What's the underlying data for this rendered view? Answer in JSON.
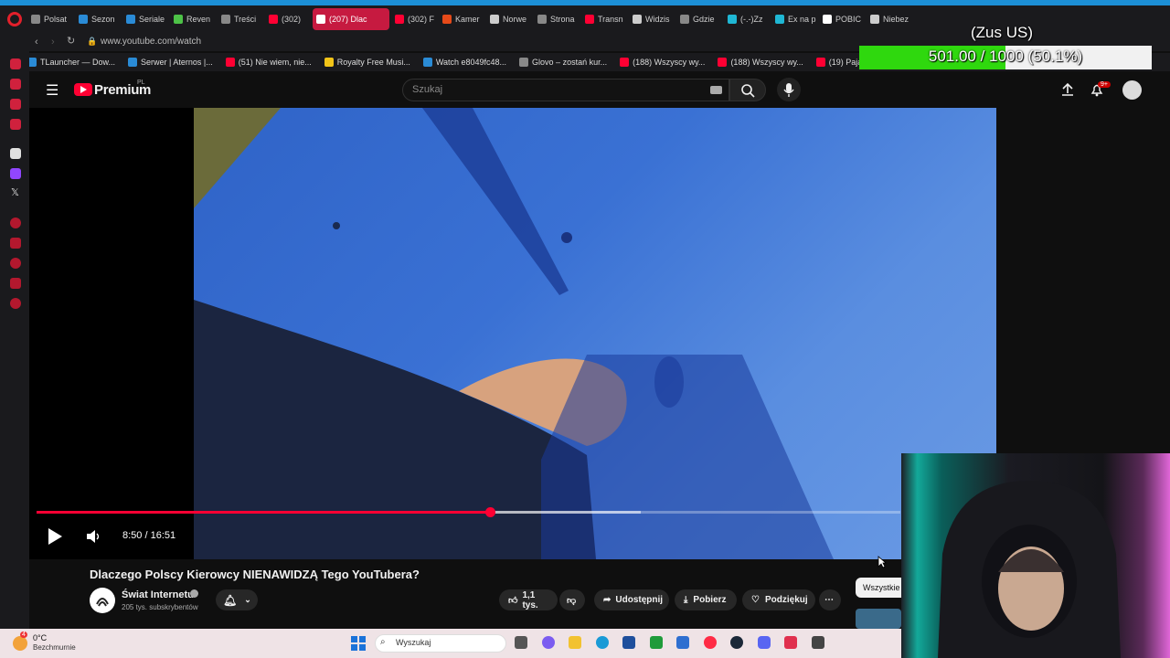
{
  "browser": {
    "tabs": [
      {
        "label": "Polsat",
        "color": "#888888"
      },
      {
        "label": "Sezon",
        "color": "#2a8bd6"
      },
      {
        "label": "Seriale",
        "color": "#2a8bd6"
      },
      {
        "label": "Reven",
        "color": "#4dc247"
      },
      {
        "label": "Treści",
        "color": "#888888"
      },
      {
        "label": "(302)",
        "color": "#ff0033"
      },
      {
        "label": "(207) Dlac",
        "color": "#ffffff",
        "active": true
      },
      {
        "label": "(302) F",
        "color": "#ff0033"
      },
      {
        "label": "Kamer",
        "color": "#e64a19"
      },
      {
        "label": "Norwe",
        "color": "#cccccc"
      },
      {
        "label": "Strona",
        "color": "#888888"
      },
      {
        "label": "Transn",
        "color": "#ff0033"
      },
      {
        "label": "Widzis",
        "color": "#cccccc"
      },
      {
        "label": "Gdzie",
        "color": "#888888"
      },
      {
        "label": "(-.-)Zz",
        "color": "#1fb7d4"
      },
      {
        "label": "Ex na p",
        "color": "#1fb7d4"
      },
      {
        "label": "POBIC",
        "color": "#ffffff"
      },
      {
        "label": "Niebez",
        "color": "#cccccc"
      }
    ],
    "url": "www.youtube.com/watch",
    "bookmarks": [
      {
        "label": "TLauncher — Dow...",
        "color": "#2a8bd6"
      },
      {
        "label": "Serwer | Aternos |...",
        "color": "#2a8bd6"
      },
      {
        "label": "(51) Nie wiem, nie...",
        "color": "#ff0033"
      },
      {
        "label": "Royalty Free Musi...",
        "color": "#f2c418"
      },
      {
        "label": "Watch e8049fc48...",
        "color": "#2a8bd6"
      },
      {
        "label": "Glovo – zostań kur...",
        "color": "#888888"
      },
      {
        "label": "(188) Wszyscy wy...",
        "color": "#ff0033"
      },
      {
        "label": "(188) Wszyscy wy...",
        "color": "#ff0033"
      },
      {
        "label": "(19) Pajalock rzuc",
        "color": "#ff0033"
      }
    ]
  },
  "youtube": {
    "logo_text": "Premium",
    "region": "PL",
    "search_placeholder": "Szukaj",
    "notification_badge": "9+",
    "video": {
      "current_time": "8:50",
      "duration": "16:51",
      "time_display": "8:50 / 16:51",
      "progress_fraction": 0.5247,
      "buffered_fraction": 0.7
    },
    "title": "Dlaczego Polscy Kierowcy NIENAWIDZĄ Tego YouTubera?",
    "channel": {
      "name": "Świat Internetu",
      "subscribers": "205 tys. subskrybentów"
    },
    "actions": {
      "likes": "1,1 tys.",
      "share": "Udostępnij",
      "download": "Pobierz",
      "thanks": "Podziękuj"
    },
    "chip_all": "Wszystkie"
  },
  "overlay": {
    "label": "(Zus US)",
    "progress_text": "501.00 / 1000 (50.1%)",
    "progress_fraction": 0.501
  },
  "taskbar": {
    "temperature": "0°C",
    "weather_desc": "Bezchmurnie",
    "weather_badge": "4",
    "search_placeholder": "Wyszukaj"
  },
  "colors": {
    "youtube_red": "#ff0033",
    "overlay_green": "#2fd80e",
    "active_tab": "#c61a40"
  }
}
